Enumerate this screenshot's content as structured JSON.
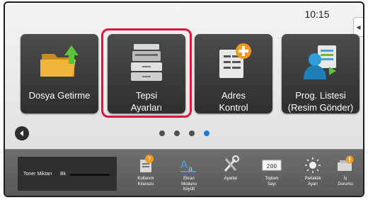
{
  "status": {
    "time": "10:15",
    "side_tab_icon": "collapse-arrow-icon"
  },
  "tiles": [
    {
      "line1": "Dosya Getirme",
      "line2": "",
      "icon": "folder-arrow-icon"
    },
    {
      "line1": "Tepsi",
      "line2": "Ayarları",
      "icon": "printer-icon",
      "selected": true
    },
    {
      "line1": "Adres",
      "line2": "Kontrol",
      "icon": "address-book-add-icon"
    },
    {
      "line1": "Prog. Listesi",
      "line2": "(Resim Gönder)",
      "icon": "user-document-icon"
    }
  ],
  "pager": {
    "pages": 4,
    "active_page": 4,
    "back_icon": "back-arrow-icon"
  },
  "toner": {
    "label": "Toner Miktarı",
    "color_label": "Bk",
    "level": 1.0
  },
  "functions": [
    {
      "label1": "Kullanım",
      "label2": "Kılavuzu",
      "label3": "",
      "icon": "manual-icon"
    },
    {
      "label1": "Ekran",
      "label2": "Modunu",
      "label3": "büyült",
      "icon": "magnify-text-icon"
    },
    {
      "label1": "Ayarlar",
      "label2": "",
      "label3": "",
      "icon": "tools-icon"
    },
    {
      "label1": "Toplam",
      "label2": "Sayı",
      "label3": "",
      "icon": "counter-icon"
    },
    {
      "label1": "Parlaklık",
      "label2": "Ayarı",
      "label3": "",
      "icon": "brightness-icon"
    },
    {
      "label1": "İş",
      "label2": "Durumu",
      "label3": "",
      "icon": "job-status-icon"
    }
  ],
  "colors": {
    "accent_red": "#d7193d",
    "active_blue": "#1a7fd6",
    "tile_dark": "#3a3a3a"
  }
}
